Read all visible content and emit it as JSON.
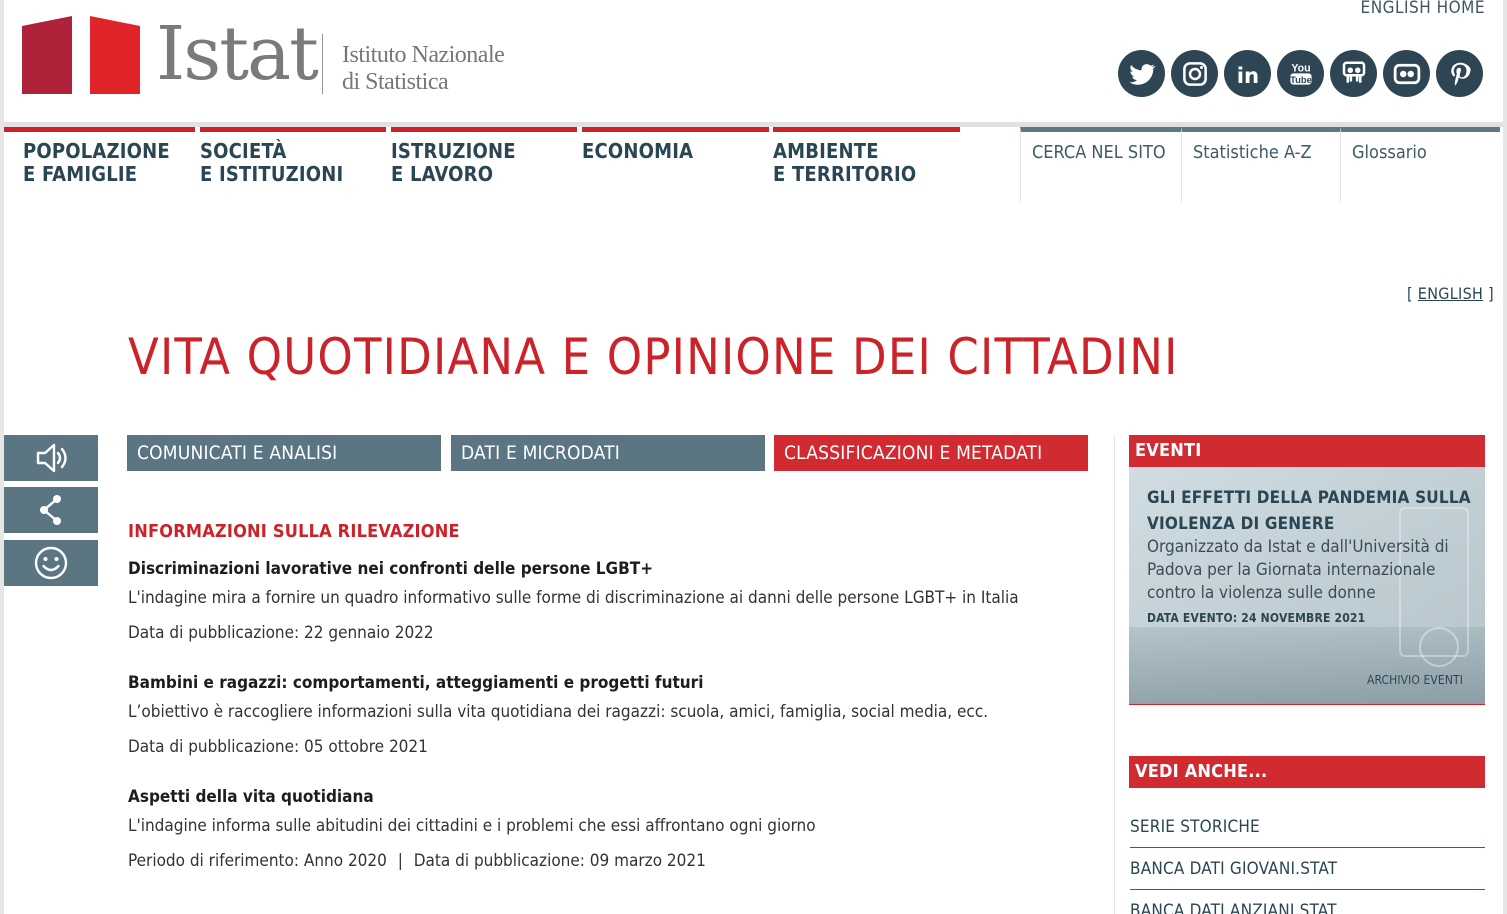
{
  "header": {
    "logo_word": "Istat",
    "logo_sub_line1": "Istituto Nazionale",
    "logo_sub_line2": "di Statistica",
    "english_home": "ENGLISH HOME",
    "social_icons": [
      "twitter-icon",
      "instagram-icon",
      "linkedin-icon",
      "youtube-icon",
      "slideshare-icon",
      "flickr-icon",
      "pinterest-icon"
    ],
    "youtube_you": "You",
    "youtube_tube": "Tube",
    "linkedin_text": "in"
  },
  "nav": {
    "main": [
      {
        "line1": "POPOLAZIONE",
        "line2": "E FAMIGLIE"
      },
      {
        "line1": "SOCIETÀ",
        "line2": "E ISTITUZIONI"
      },
      {
        "line1": "ISTRUZIONE",
        "line2": "E LAVORO"
      },
      {
        "line1": "ECONOMIA",
        "line2": ""
      },
      {
        "line1": "AMBIENTE",
        "line2": "E TERRITORIO"
      }
    ],
    "utility": [
      "CERCA NEL SITO",
      "Statistiche A-Z",
      "Glossario"
    ]
  },
  "lang_switch": {
    "open": "[",
    "label": "ENGLISH",
    "close": "]"
  },
  "page_title": "VITA QUOTIDIANA E OPINIONE DEI CITTADINI",
  "tabs": [
    "COMUNICATI E ANALISI",
    "DATI E MICRODATI",
    "CLASSIFICAZIONI E METADATI"
  ],
  "section_title": "INFORMAZIONI SULLA RILEVAZIONE",
  "surveys": [
    {
      "title": "Discriminazioni lavorative nei confronti delle persone LGBT+",
      "description": "L'indagine mira a fornire un quadro informativo sulle forme di discriminazione ai danni delle persone LGBT+ in Italia",
      "meta": "Data di pubblicazione: 22 gennaio 2022"
    },
    {
      "title": "Bambini e ragazzi: comportamenti, atteggiamenti e progetti futuri",
      "description": "L’obiettivo è raccogliere informazioni sulla vita quotidiana dei ragazzi: scuola, amici, famiglia, social media, ecc.",
      "meta": "Data di pubblicazione: 05 ottobre 2021"
    },
    {
      "title": "Aspetti della vita quotidiana",
      "description": "L'indagine informa sulle abitudini dei cittadini e i problemi che essi affrontano ogni giorno",
      "meta_period": "Periodo di riferimento: Anno 2020",
      "meta_separator": "|",
      "meta": "Data di pubblicazione: 09 marzo 2021"
    }
  ],
  "events": {
    "header": "EVENTI",
    "title": "GLI EFFETTI DELLA PANDEMIA SULLA VIOLENZA DI GENERE",
    "description": "Organizzato da Istat e dall'Università di Padova per la Giornata internazionale contro la violenza sulle donne",
    "date": "DATA EVENTO: 24 NOVEMBRE 2021",
    "archive": "ARCHIVIO EVENTI"
  },
  "see_also": {
    "header": "VEDI ANCHE...",
    "items": [
      "SERIE STORICHE",
      "BANCA DATI GIOVANI.STAT",
      "BANCA DATI ANZIANI.STAT"
    ]
  },
  "colors": {
    "brand_red": "#cc2229",
    "nav_blue": "#2b4653",
    "tab_grey": "#5b7682",
    "logo_dark_red": "#b0223a",
    "logo_red": "#e0242a"
  }
}
